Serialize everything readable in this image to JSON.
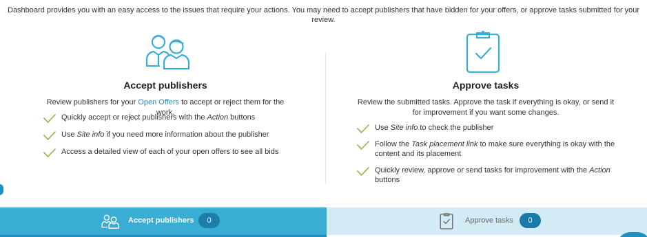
{
  "intro": "Dashboard provides you with an easy access to the issues that require your actions. You may need to accept publishers that have bidden for your offers, or approve tasks submitted for your review.",
  "accept": {
    "icon": "publishers-icon",
    "title": "Accept publishers",
    "desc_before": "Review publishers for your ",
    "desc_link": "Open Offers",
    "desc_after": " to accept or reject them for the work.",
    "items": [
      {
        "before": "Quickly accept or reject publishers with the ",
        "em": "Action",
        "after": " buttons"
      },
      {
        "before": "Use ",
        "em": "Site info",
        "after": " if you need more information about the publisher"
      },
      {
        "before": "Access a detailed view of each of your open offers to see all bids",
        "em": "",
        "after": ""
      }
    ]
  },
  "approve": {
    "icon": "clipboard-check-icon",
    "title": "Approve tasks",
    "desc": "Review the submitted tasks. Approve the task if everything is okay, or send it for improvement if you want some changes.",
    "items": [
      {
        "before": "Use ",
        "em": "Site info",
        "after": " to check the publisher"
      },
      {
        "before": "Follow the ",
        "em": "Task placement link",
        "after": " to make sure everything is okay with the content and its placement"
      },
      {
        "before": "Quickly review, approve or send tasks for improvement with the ",
        "em": "Action",
        "after": " buttons"
      }
    ]
  },
  "tabs": [
    {
      "label": "Accept publishers",
      "count": "0",
      "active": true
    },
    {
      "label": "Approve tasks",
      "count": "0",
      "active": false
    }
  ],
  "colors": {
    "accent": "#3aadd4",
    "accent_dark": "#1e8fc0",
    "check": "#8ab34a",
    "inactive_tab": "#d3ebf4"
  }
}
